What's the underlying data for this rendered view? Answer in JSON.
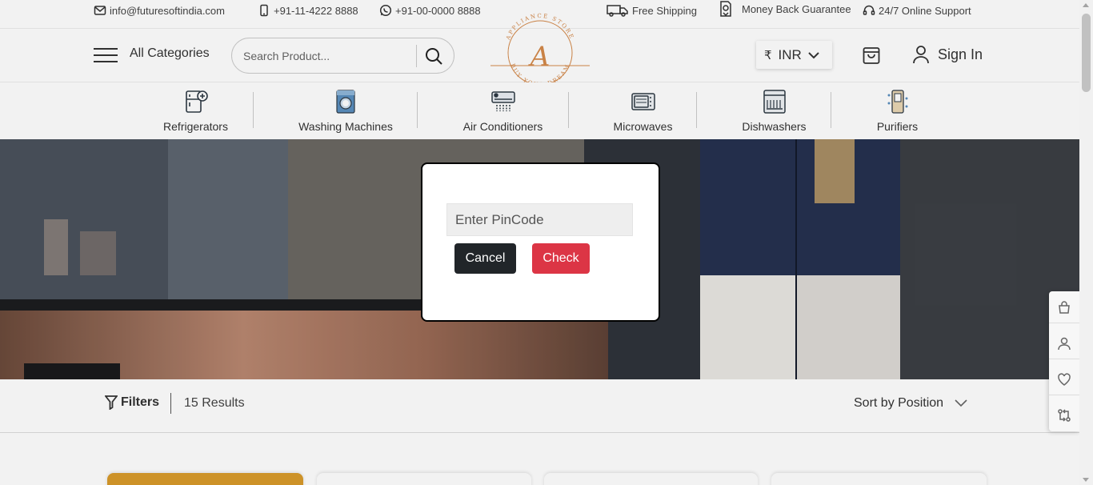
{
  "topbar": {
    "email": "info@futuresoftindia.com",
    "phone": "+91-11-4222 8888",
    "whatsapp": "+91-00-0000 8888",
    "shipping": "Free Shipping",
    "guarantee": "Money Back Guarantee",
    "support": "24/7 Online Support"
  },
  "header": {
    "all_categories": "All Categories",
    "search_placeholder": "Search Product...",
    "logo_letter": "A",
    "logo_text_top": "APPLIANCE STORE",
    "logo_text_bottom": "BUY YOUR DREAM",
    "currency_symbol": "₹",
    "currency": "INR",
    "sign_in": "Sign In"
  },
  "categories": [
    {
      "label": "Refrigerators",
      "icon": "refrigerator-icon"
    },
    {
      "label": "Washing Machines",
      "icon": "washing-machine-icon"
    },
    {
      "label": "Air Conditioners",
      "icon": "air-conditioner-icon"
    },
    {
      "label": "Microwaves",
      "icon": "microwave-icon"
    },
    {
      "label": "Dishwashers",
      "icon": "dishwasher-icon"
    },
    {
      "label": "Purifiers",
      "icon": "purifier-icon"
    }
  ],
  "listing": {
    "filters_label": "Filters",
    "results": "15 Results",
    "sort_label": "Sort by Position"
  },
  "modal": {
    "pincode_placeholder": "Enter PinCode",
    "cancel_label": "Cancel",
    "check_label": "Check"
  },
  "colors": {
    "logo_accent": "#d4894a",
    "check_button": "#dc3545",
    "cancel_button": "#212529"
  }
}
